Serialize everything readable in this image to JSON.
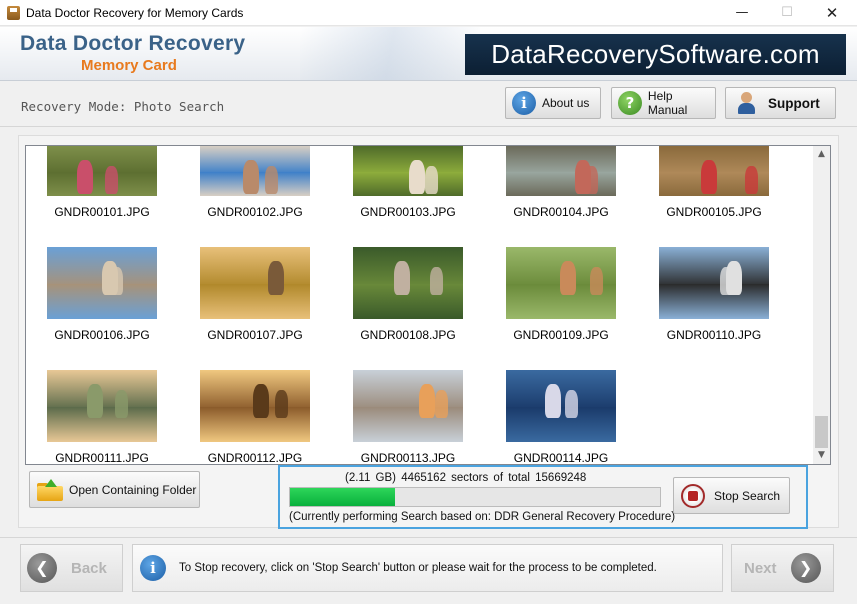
{
  "window": {
    "title": "Data Doctor Recovery for Memory Cards",
    "minimize_glyph": "—",
    "maximize_glyph": "☐",
    "close_glyph": "✕"
  },
  "header": {
    "brand_title": "Data Doctor Recovery",
    "brand_subtitle": "Memory Card",
    "site_name": "DataRecoverySoftware.com",
    "title_color": "#3a6288",
    "subtitle_color": "#e87a1e"
  },
  "toolbar": {
    "mode_label": "Recovery Mode: Photo Search",
    "about_label": "About us",
    "help_label": "Help Manual",
    "support_label": "Support",
    "about_icon": "i",
    "help_icon": "?"
  },
  "gallery": {
    "items": [
      {
        "filename": "GNDR00101.JPG",
        "colors": [
          "#7e8f4a",
          "#5c6e30",
          "#c94f6a"
        ]
      },
      {
        "filename": "GNDR00102.JPG",
        "colors": [
          "#d8cfc4",
          "#3c7fc9",
          "#b98a6a"
        ]
      },
      {
        "filename": "GNDR00103.JPG",
        "colors": [
          "#4f6b2a",
          "#8fae3c",
          "#e8dccb"
        ]
      },
      {
        "filename": "GNDR00104.JPG",
        "colors": [
          "#6b6a5a",
          "#9aa7a0",
          "#c2685a"
        ]
      },
      {
        "filename": "GNDR00105.JPG",
        "colors": [
          "#8a6a3c",
          "#b08a5a",
          "#c93a3a"
        ]
      },
      {
        "filename": "GNDR00106.JPG",
        "colors": [
          "#6aa0d6",
          "#a89278",
          "#d8c8b0"
        ]
      },
      {
        "filename": "GNDR00107.JPG",
        "colors": [
          "#e8c07a",
          "#b0882a",
          "#7a5a3a"
        ]
      },
      {
        "filename": "GNDR00108.JPG",
        "colors": [
          "#3a5a2a",
          "#6a8a3a",
          "#c0b0a0"
        ]
      },
      {
        "filename": "GNDR00109.JPG",
        "colors": [
          "#9ab86a",
          "#6a8a3a",
          "#c98a5a"
        ]
      },
      {
        "filename": "GNDR00110.JPG",
        "colors": [
          "#8ab0d6",
          "#2a2a2a",
          "#e0e0e0"
        ]
      },
      {
        "filename": "GNDR00111.JPG",
        "colors": [
          "#e8c896",
          "#5a6a4a",
          "#8a9a6a"
        ]
      },
      {
        "filename": "GNDR00112.JPG",
        "colors": [
          "#f0c880",
          "#8a5a2a",
          "#5a3a1a"
        ]
      },
      {
        "filename": "GNDR00113.JPG",
        "colors": [
          "#c8d0d8",
          "#9a8a7a",
          "#e8a05a"
        ]
      },
      {
        "filename": "GNDR00114.JPG",
        "colors": [
          "#3a6aa0",
          "#1a3a6a",
          "#d8d8e8"
        ]
      }
    ]
  },
  "actions": {
    "open_folder_label": "Open Containing Folder",
    "stop_label": "Stop Search"
  },
  "progress": {
    "sectors_text": "(2.11 GB) 4465162  sectors  of  total 15669248",
    "status_text": "(Currently performing Search based on:  DDR General Recovery Procedure)",
    "sectors_done": 4465162,
    "sectors_total": 15669248,
    "fill_color": "#08b03c"
  },
  "footer": {
    "back_label": "Back",
    "next_label": "Next",
    "back_glyph": "❮",
    "next_glyph": "❯",
    "info_icon": "i",
    "info_message": "To Stop recovery, click on 'Stop Search' button or please wait for the process to be completed."
  },
  "scrollbar": {
    "up_glyph": "▲",
    "down_glyph": "▼"
  }
}
